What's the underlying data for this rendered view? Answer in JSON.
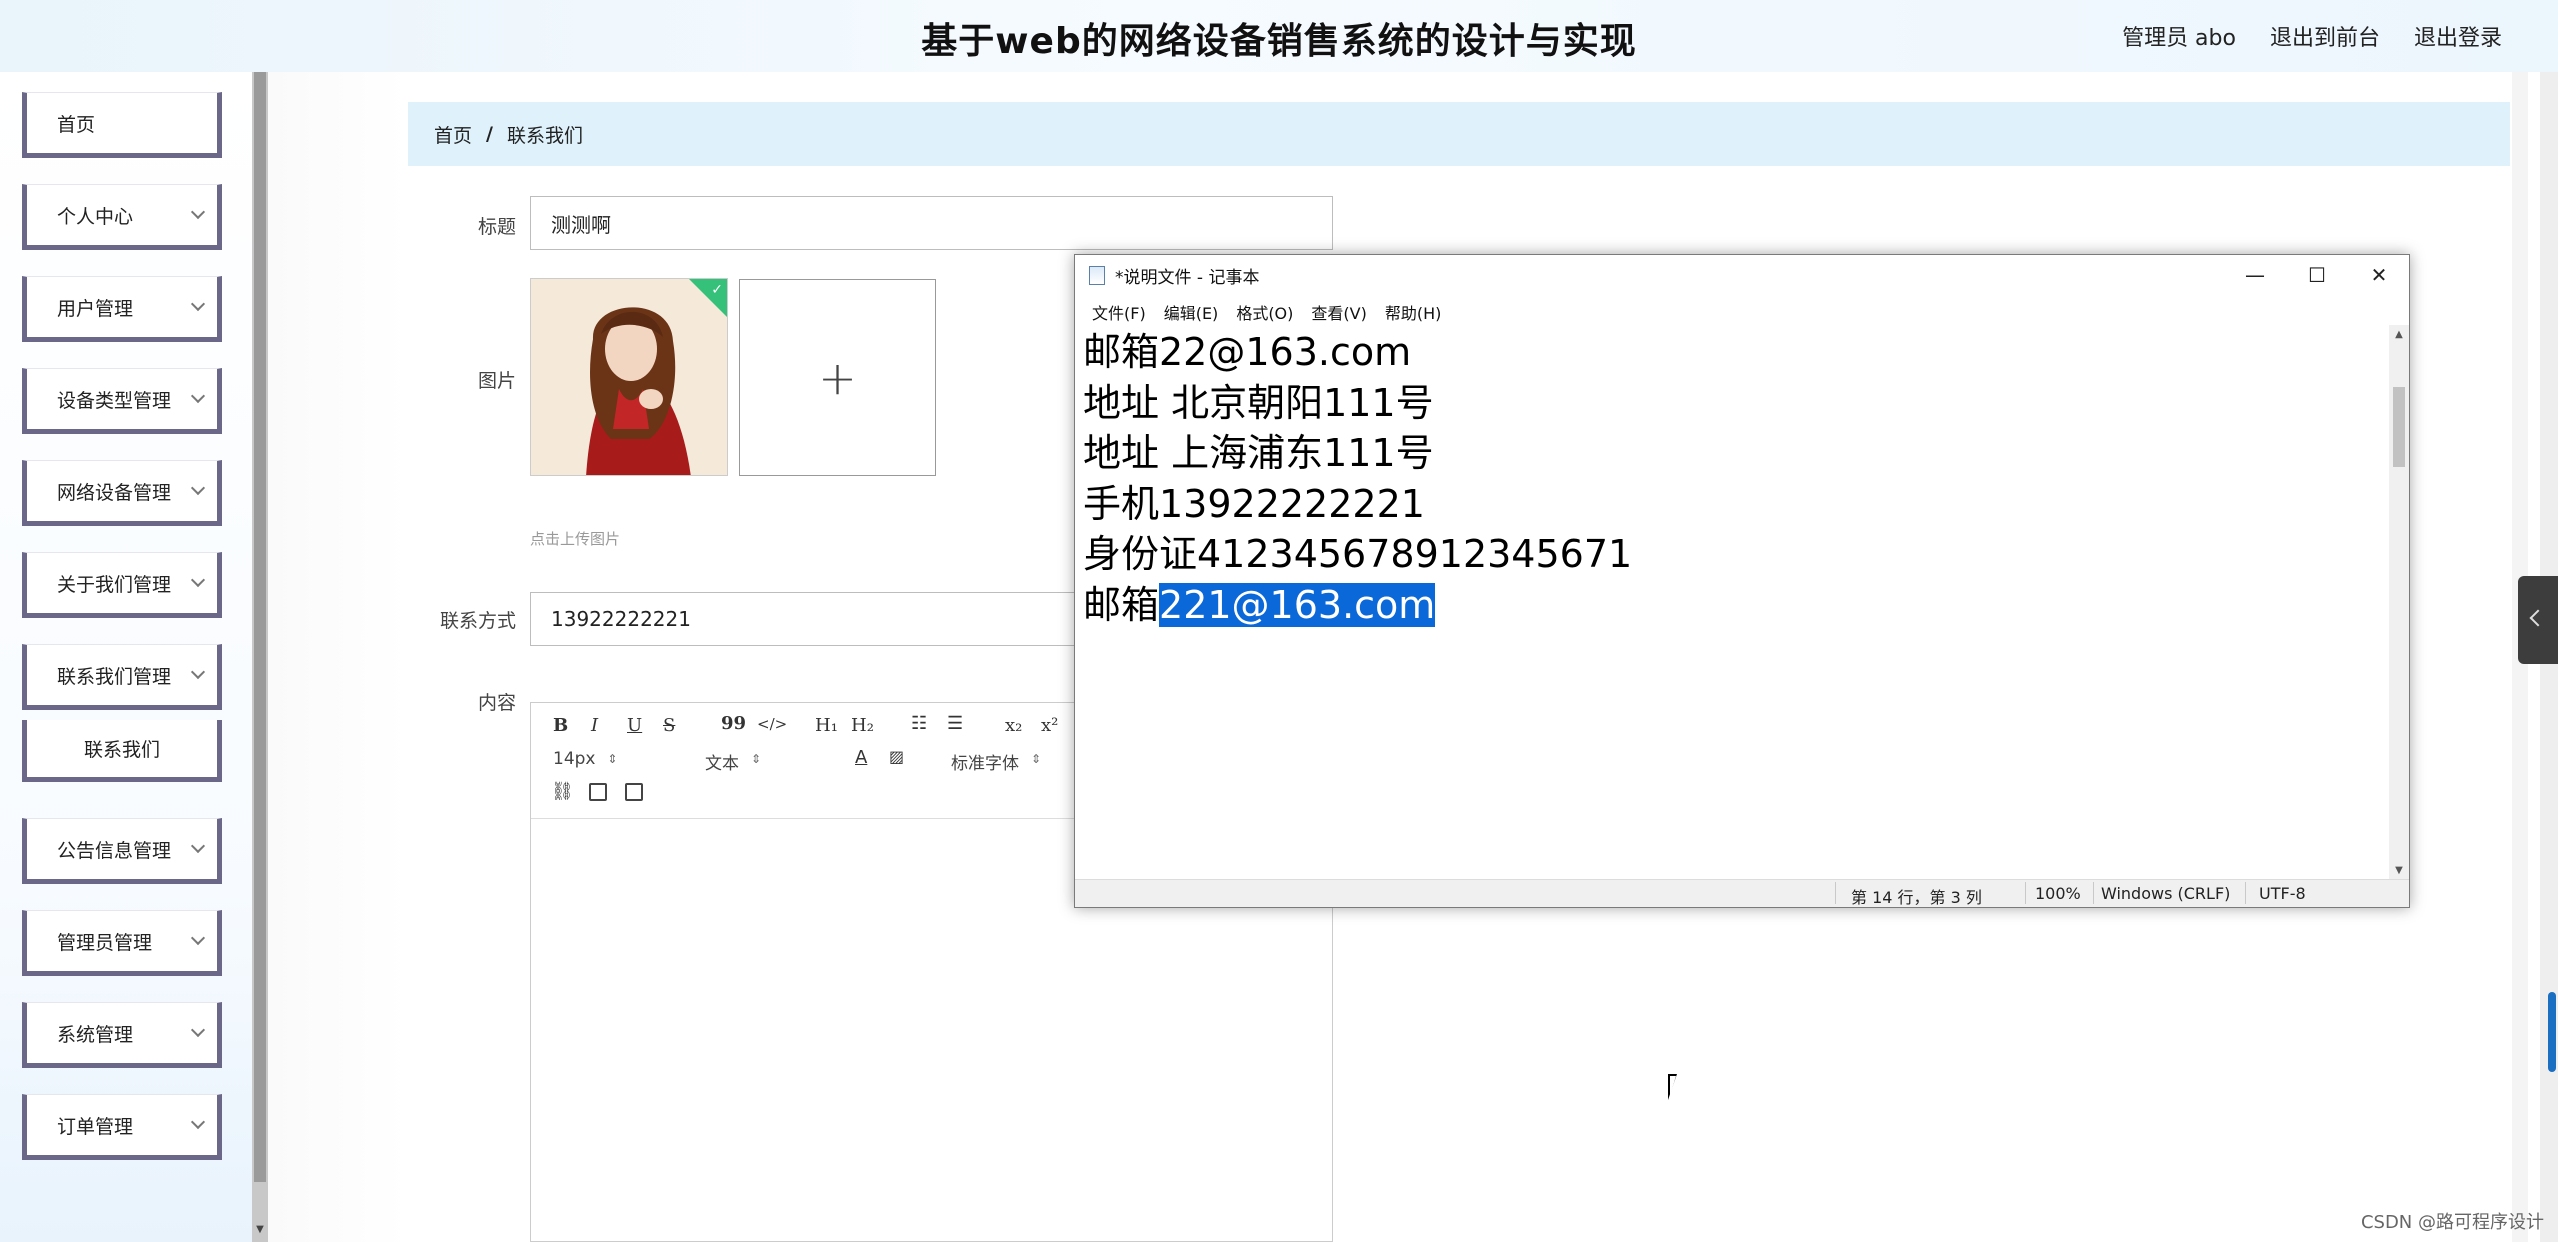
{
  "header": {
    "title": "基于web的网络设备销售系统的设计与实现",
    "user_label": "管理员 abo",
    "back_front": "退出到前台",
    "logout": "退出登录"
  },
  "sidebar": {
    "items": [
      {
        "label": "首页"
      },
      {
        "label": "个人中心"
      },
      {
        "label": "用户管理"
      },
      {
        "label": "设备类型管理"
      },
      {
        "label": "网络设备管理"
      },
      {
        "label": "关于我们管理"
      },
      {
        "label": "联系我们管理"
      },
      {
        "label": "联系我们"
      },
      {
        "label": "公告信息管理"
      },
      {
        "label": "管理员管理"
      },
      {
        "label": "系统管理"
      },
      {
        "label": "订单管理"
      }
    ]
  },
  "breadcrumb": {
    "home": "首页",
    "separator": "/",
    "current": "联系我们"
  },
  "form": {
    "title_label": "标题",
    "title_value": "测测啊",
    "image_label": "图片",
    "upload_hint": "点击上传图片",
    "contact_label": "联系方式",
    "contact_value": "13922222221",
    "content_label": "内容"
  },
  "editor": {
    "bold": "B",
    "italic": "I",
    "underline": "U",
    "strike": "S",
    "quote": "99",
    "code": "</>",
    "h1": "H₁",
    "h2": "H₂",
    "subscript": "x₂",
    "superscript": "x²",
    "font_size": "14px",
    "block_type": "文本",
    "font_family": "标准字体",
    "font_color": "A"
  },
  "notepad": {
    "title": "*说明文件 - 记事本",
    "menu": [
      "文件(F)",
      "编辑(E)",
      "格式(O)",
      "查看(V)",
      "帮助(H)"
    ],
    "lines": [
      "邮箱22@163.com",
      "",
      "地址 北京朝阳111号",
      "地址 上海浦东111号",
      "",
      "手机13922222221",
      "身份证412345678912345671"
    ],
    "last_line_plain": "邮箱",
    "last_line_selected": "221@163.com",
    "status": {
      "position": "第 14 行，第 3 列",
      "zoom": "100%",
      "line_ending": "Windows (CRLF)",
      "encoding": "UTF-8"
    }
  },
  "watermark": "CSDN @路可程序设计"
}
